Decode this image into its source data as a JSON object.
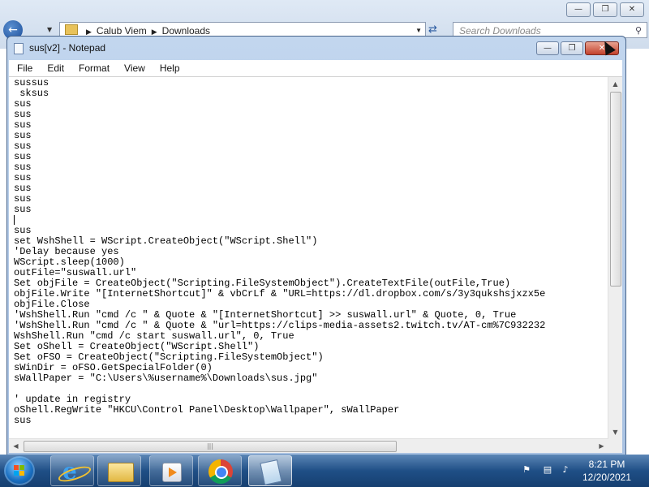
{
  "explorer": {
    "breadcrumb": [
      "Calub Viem",
      "Downloads"
    ],
    "search_placeholder": "Search Downloads"
  },
  "notepad": {
    "title": "sus[v2] - Notepad",
    "menu": [
      "File",
      "Edit",
      "Format",
      "View",
      "Help"
    ],
    "content_lines": [
      "sussus",
      " sksus",
      "sus",
      "sus",
      "sus",
      "sus",
      "sus",
      "sus",
      "sus",
      "sus",
      "sus",
      "sus",
      "sus",
      "",
      "sus",
      "set WshShell = WScript.CreateObject(\"WScript.Shell\")",
      "'Delay because yes",
      "WScript.sleep(1000)",
      "outFile=\"suswall.url\"",
      "Set objFile = CreateObject(\"Scripting.FileSystemObject\").CreateTextFile(outFile,True)",
      "objFile.Write \"[InternetShortcut]\" & vbCrLf & \"URL=https://dl.dropbox.com/s/3y3qukshsjxzx5e",
      "objFile.Close",
      "'WshShell.Run \"cmd /c \" & Quote & \"[InternetShortcut] >> suswall.url\" & Quote, 0, True",
      "'WshShell.Run \"cmd /c \" & Quote & \"url=https://clips-media-assets2.twitch.tv/AT-cm%7C932232",
      "WshShell.Run \"cmd /c start suswall.url\", 0, True",
      "Set oShell = CreateObject(\"WScript.Shell\")",
      "Set oFSO = CreateObject(\"Scripting.FileSystemObject\")",
      "sWinDir = oFSO.GetSpecialFolder(0)",
      "sWallPaper = \"C:\\Users\\%username%\\Downloads\\sus.jpg\"",
      "",
      "' update in registry",
      "oShell.RegWrite \"HKCU\\Control Panel\\Desktop\\Wallpaper\", sWallPaper",
      "sus"
    ],
    "caret_line": 13
  },
  "taskbar": {
    "apps": [
      "internet-explorer",
      "windows-explorer",
      "media-player",
      "chrome",
      "notepad"
    ],
    "active_app": "notepad",
    "time": "8:21 PM",
    "date": "12/20/2021"
  },
  "colors": {
    "taskbar": "#1f4f86",
    "close_button": "#c2412c",
    "title_bar": "#b6cce8"
  }
}
